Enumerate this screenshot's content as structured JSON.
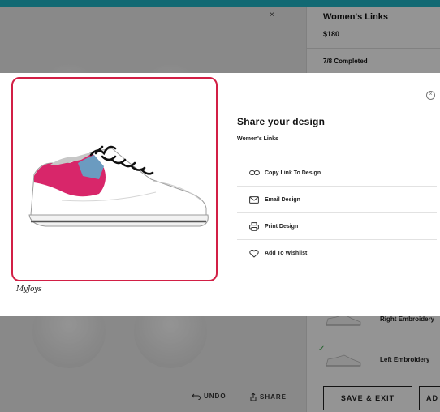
{
  "background": {
    "close_glyph": "×",
    "product": {
      "name": "Women's Links",
      "price": "$180",
      "progress": "7/8 Completed"
    },
    "steps": [
      {
        "label": "Right Embroidery",
        "completed": false
      },
      {
        "label": "Left Embroidery",
        "completed": true
      }
    ],
    "check_glyph": "✓",
    "toolbar": {
      "undo_label": "UNDO",
      "share_label": "SHARE"
    },
    "actions": {
      "save_exit_label": "SAVE & EXIT",
      "add_label": "AD"
    },
    "colors": {
      "accent_teal": "#1fb5c6",
      "check_green": "#3aa84a"
    }
  },
  "share_modal": {
    "title": "Share your design",
    "product_name": "Women's Links",
    "brand_logo": "MyJoys",
    "close_glyph": "×",
    "preview_border_color": "#d21f45",
    "options": [
      {
        "label": "Copy Link To Design",
        "icon": "link-icon"
      },
      {
        "label": "Email Design",
        "icon": "envelope-icon"
      },
      {
        "label": "Print Design",
        "icon": "printer-icon"
      },
      {
        "label": "Add To Wishlist",
        "icon": "heart-icon"
      }
    ],
    "shoe_colors": {
      "upper": "#ffffff",
      "heel_panel": "#d8266a",
      "accent_panel": "#6b9bc0",
      "laces": "#111111",
      "sole": "#f3f3f3"
    }
  }
}
